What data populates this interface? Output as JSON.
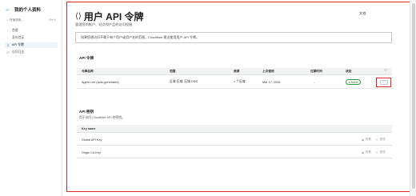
{
  "sidebar": {
    "back_label": "我的个人资料",
    "search_placeholder": "快速搜索...",
    "search_shortcut": "Ctrl+K",
    "items": [
      {
        "icon": "user-icon",
        "label": "首要"
      },
      {
        "icon": "user-icon",
        "label": "身份验证"
      },
      {
        "icon": "key-icon",
        "label": "API 令牌"
      },
      {
        "icon": "clock-icon",
        "label": "访问日志"
      }
    ]
  },
  "header": {
    "title": "用户 API 令牌",
    "subtitle": "管理您的帐户、站点和产品的访问权限",
    "language": "文档"
  },
  "notice": "如果您想访问不属于每个用户或用户名的范围，Cloudflare 建议使用用户 API 令牌。",
  "tokens_section": {
    "heading": "API 令牌",
    "columns": [
      "令牌名称",
      "范围",
      "资源",
      "上次使用",
      "过期时间",
      "状态"
    ],
    "rows": [
      {
        "name": "Agent Lee (auto-generated)",
        "scope": "区域:区域, 区域 DNS",
        "resources": "1 个区域",
        "last_used": "Mar 17, 2026",
        "expires": "-",
        "status": "Active",
        "more": "···"
      }
    ]
  },
  "keys_section": {
    "heading": "API 密钥",
    "subheading": "用于访问 Cloudflare API 的密钥。",
    "column": "Key name",
    "rows": [
      {
        "name": "Global API Key",
        "actions": [
          "查看",
          "更改"
        ]
      },
      {
        "name": "Origin CA Key",
        "actions": [
          "查看",
          "更改"
        ]
      }
    ]
  },
  "colors": {
    "accent": "#0a5fd6",
    "highlight": "#e02a2a",
    "active_badge": "#2f9e44"
  }
}
